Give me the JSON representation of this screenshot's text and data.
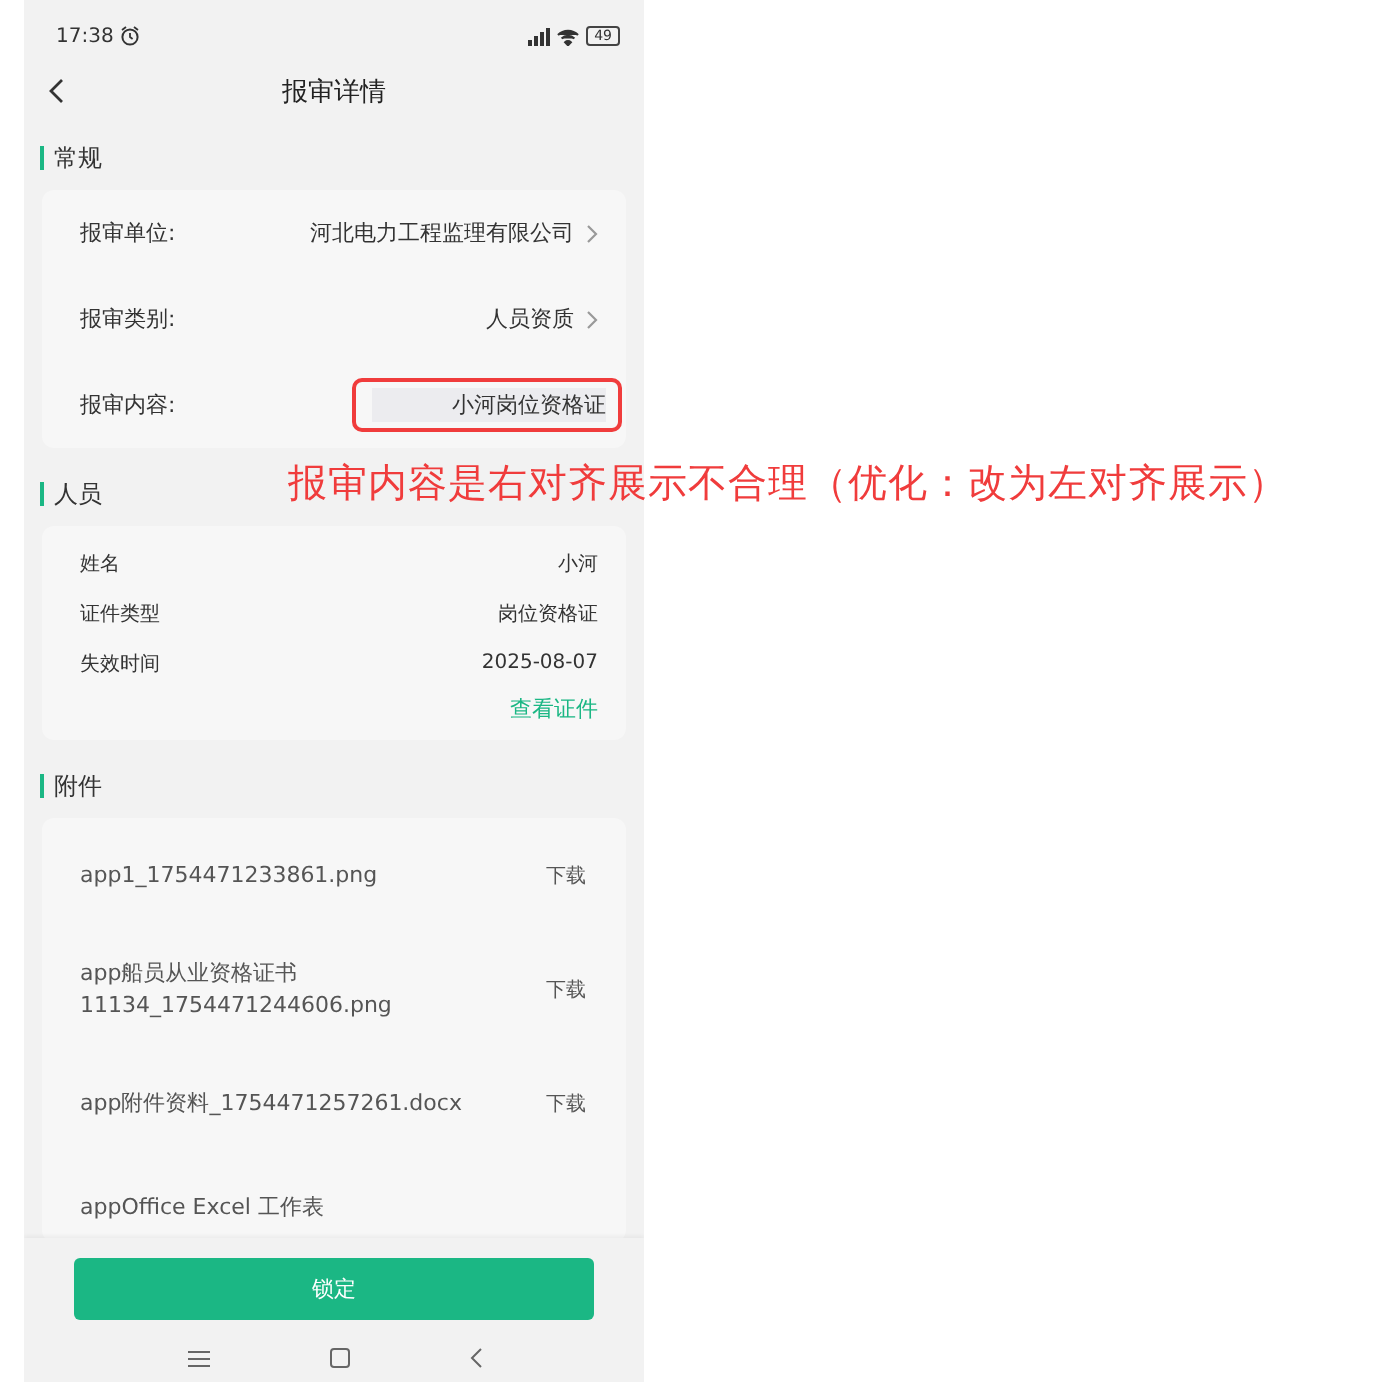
{
  "status_bar": {
    "time": "17:38",
    "battery": "49"
  },
  "header": {
    "title": "报审详情"
  },
  "general": {
    "title": "常规",
    "rows": [
      {
        "label": "报审单位:",
        "value": "河北电力工程监理有限公司",
        "chevron": true,
        "annotated": false
      },
      {
        "label": "报审类别:",
        "value": "人员资质",
        "chevron": true,
        "annotated": false
      },
      {
        "label": "报审内容:",
        "value": "小河岗位资格证",
        "chevron": false,
        "annotated": true
      }
    ]
  },
  "person": {
    "title": "人员",
    "rows": [
      {
        "label": "姓名",
        "value": "小河"
      },
      {
        "label": "证件类型",
        "value": "岗位资格证"
      },
      {
        "label": "失效时间",
        "value": "2025-08-07"
      }
    ],
    "link": "查看证件"
  },
  "attachments": {
    "title": "附件",
    "files": [
      {
        "name": "app1_1754471233861.png",
        "action": "下载"
      },
      {
        "name": "app船员从业资格证书11134_1754471244606.png",
        "action": "下载"
      },
      {
        "name": "app附件资料_1754471257261.docx",
        "action": "下载"
      },
      {
        "name": "appOffice Excel 工作表"
      }
    ]
  },
  "footer": {
    "button": "锁定"
  },
  "annotation": {
    "text": "报审内容是右对齐展示不合理（优化：改为左对齐展示）"
  }
}
